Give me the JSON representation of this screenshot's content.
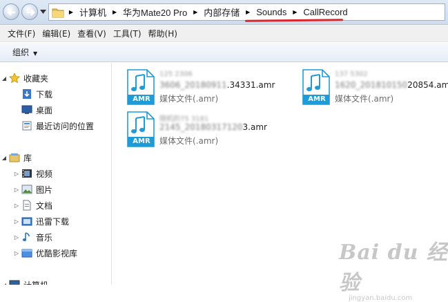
{
  "address_bar": {
    "breadcrumbs": [
      "计算机",
      "华为Mate20 Pro",
      "内部存储",
      "Sounds",
      "CallRecord"
    ]
  },
  "menu": [
    "文件(F)",
    "编辑(E)",
    "查看(V)",
    "工具(T)",
    "帮助(H)"
  ],
  "toolbar": {
    "organize_label": "组织"
  },
  "nav_pane": {
    "favorites": {
      "label": "收藏夹",
      "items": [
        "下载",
        "桌面",
        "最近访问的位置"
      ]
    },
    "libraries": {
      "label": "库",
      "items": [
        "视频",
        "图片",
        "文档",
        "迅雷下载",
        "音乐",
        "优酷影视库"
      ]
    },
    "computer": {
      "label": "计算机"
    }
  },
  "files": [
    {
      "icon_label": "AMR",
      "name_line1": "125 2306",
      "name_prefix": "3606_20180911",
      "name_visible": ".34331.amr",
      "type": "媒体文件(.amr)"
    },
    {
      "icon_label": "AMR",
      "name_line1": "137 5302",
      "name_prefix": "1620_201810150",
      "name_visible": "20854.amr",
      "type": "媒体文件(.amr)"
    },
    {
      "icon_label": "AMR",
      "name_line1": "随机的75 3181",
      "name_prefix": "2145_20180317120",
      "name_visible": "3.amr",
      "type": "媒体文件(.amr)"
    }
  ],
  "watermark": {
    "brand": "Bai du 经验",
    "url": "jingyan.baidu.com"
  },
  "colors": {
    "amr_blue": "#1f9bd7",
    "highlight_red": "#d9262b"
  }
}
